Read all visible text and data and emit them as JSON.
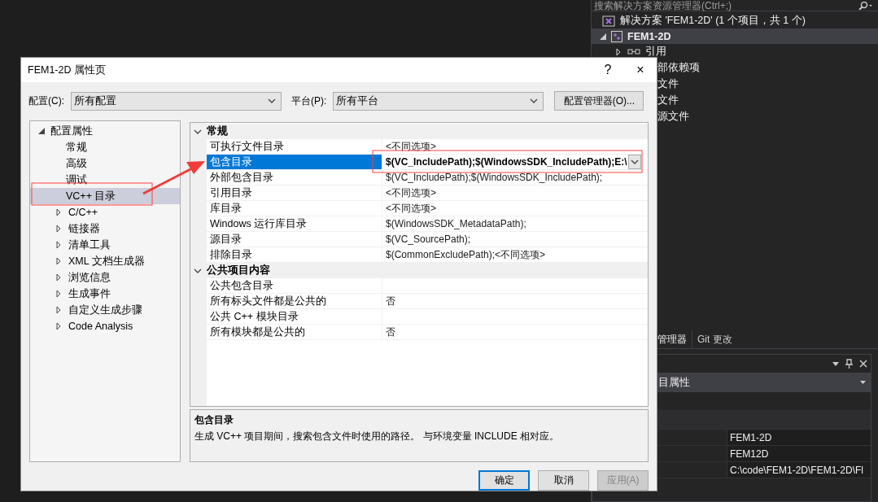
{
  "solution_explorer": {
    "search_placeholder": "搜索解决方案资源管理器(Ctrl+;)",
    "tree": [
      {
        "label": "解决方案 'FEM1-2D' (1 个项目，共 1 个)",
        "kind": "solution",
        "selected": false,
        "children": [
          {
            "label": "FEM1-2D",
            "kind": "project",
            "expanded": true,
            "selected": true,
            "children": [
              {
                "label": "引用",
                "kind": "references",
                "expanded": false,
                "selected": false
              },
              {
                "label": "部依赖项",
                "kind": "covered"
              },
              {
                "label": "文件",
                "kind": "covered"
              },
              {
                "label": "文件",
                "kind": "covered"
              },
              {
                "label": "源文件",
                "kind": "covered"
              }
            ]
          }
        ]
      }
    ]
  },
  "panel_tabs": [
    {
      "label": "管理器",
      "selected": true
    },
    {
      "label": "Git 更改",
      "selected": false
    }
  ],
  "properties_panel": {
    "dropdown": "目属性",
    "rows": [
      {
        "kind": "blank"
      },
      {
        "kind": "category"
      },
      {
        "value": "FEM1-2D",
        "kind": "value"
      },
      {
        "value": "FEM12D",
        "kind": "value"
      },
      {
        "value": "C:\\code\\FEM1-2D\\FEM1-2D\\Fl",
        "kind": "value"
      }
    ]
  },
  "dialog": {
    "title": "FEM1-2D 属性页",
    "help": "?",
    "close": "×",
    "configuration": {
      "label": "配置(C):",
      "value": "所有配置"
    },
    "platform": {
      "label": "平台(P):",
      "value": "所有平台"
    },
    "manager_button": "配置管理器(O)...",
    "tree": [
      {
        "label": "配置属性",
        "expanded": true,
        "selected": false,
        "children": [
          {
            "label": "常规",
            "selected": false
          },
          {
            "label": "高级",
            "selected": false
          },
          {
            "label": "调试",
            "selected": false
          },
          {
            "label": "VC++ 目录",
            "selected": true
          },
          {
            "label": "C/C++",
            "expanded": false,
            "selected": false
          },
          {
            "label": "链接器",
            "expanded": false,
            "selected": false
          },
          {
            "label": "清单工具",
            "expanded": false,
            "selected": false
          },
          {
            "label": "XML 文档生成器",
            "expanded": false,
            "selected": false
          },
          {
            "label": "浏览信息",
            "expanded": false,
            "selected": false
          },
          {
            "label": "生成事件",
            "expanded": false,
            "selected": false
          },
          {
            "label": "自定义生成步骤",
            "expanded": false,
            "selected": false
          },
          {
            "label": "Code Analysis",
            "expanded": false,
            "selected": false
          }
        ]
      }
    ],
    "grid": [
      {
        "category": "常规",
        "expanded": true,
        "properties": [
          {
            "name": "可执行文件目录",
            "value": "<不同选项>",
            "selected": false,
            "modified": false
          },
          {
            "name": "包含目录",
            "value": "$(VC_IncludePath);$(WindowsSDK_IncludePath);E:\\",
            "selected": true,
            "modified": true
          },
          {
            "name": "外部包含目录",
            "value": "$(VC_IncludePath);$(WindowsSDK_IncludePath);",
            "selected": false,
            "modified": false
          },
          {
            "name": "引用目录",
            "value": "<不同选项>",
            "selected": false,
            "modified": false
          },
          {
            "name": "库目录",
            "value": "<不同选项>",
            "selected": false,
            "modified": false
          },
          {
            "name": "Windows 运行库目录",
            "value": "$(WindowsSDK_MetadataPath);",
            "selected": false,
            "modified": false
          },
          {
            "name": "源目录",
            "value": "$(VC_SourcePath);",
            "selected": false,
            "modified": false
          },
          {
            "name": "排除目录",
            "value": "$(CommonExcludePath);<不同选项>",
            "selected": false,
            "modified": false
          }
        ]
      },
      {
        "category": "公共项目内容",
        "expanded": true,
        "properties": [
          {
            "name": "公共包含目录",
            "selected": false
          },
          {
            "name": "所有标头文件都是公共的",
            "value": "否",
            "selected": false,
            "modified": false
          },
          {
            "name": "公共 C++ 模块目录",
            "selected": false
          },
          {
            "name": "所有模块都是公共的",
            "value": "否",
            "selected": false,
            "modified": false
          }
        ]
      }
    ],
    "description": {
      "title": "包含目录",
      "text": "生成 VC++ 项目期间，搜索包含文件时使用的路径。  与环境变量 INCLUDE 相对应。"
    },
    "buttons": [
      {
        "label": "确定",
        "kind": "default",
        "disabled": false
      },
      {
        "label": "取消",
        "kind": "normal",
        "disabled": false
      },
      {
        "label": "应用(A)",
        "kind": "normal",
        "disabled": true
      }
    ]
  }
}
